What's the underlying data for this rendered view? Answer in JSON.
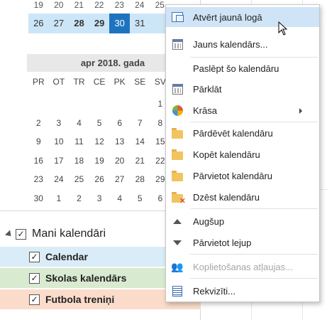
{
  "mini_calendar": {
    "prev_week_row": [
      "19",
      "20",
      "21",
      "22",
      "23",
      "24",
      "25"
    ],
    "selected_week_row": [
      "26",
      "27",
      "28",
      "29",
      "30",
      "31"
    ],
    "month_title": "apr 2018. gada",
    "weekdays": [
      "PR",
      "OT",
      "TR",
      "CE",
      "PK",
      "SE",
      "SV"
    ],
    "weeks": [
      [
        "",
        "",
        "",
        "",
        "",
        "",
        "1"
      ],
      [
        "2",
        "3",
        "4",
        "5",
        "6",
        "7",
        "8"
      ],
      [
        "9",
        "10",
        "11",
        "12",
        "13",
        "14",
        "15"
      ],
      [
        "16",
        "17",
        "18",
        "19",
        "20",
        "21",
        "22"
      ],
      [
        "23",
        "24",
        "25",
        "26",
        "27",
        "28",
        "29"
      ],
      [
        "30",
        "1",
        "2",
        "3",
        "4",
        "5",
        "6"
      ]
    ]
  },
  "calendars": {
    "group_label": "Mani kalendāri",
    "items": [
      {
        "label": "Calendar",
        "color": "#d9ecf7"
      },
      {
        "label": "Skolas kalendārs",
        "color": "#d8ead0"
      },
      {
        "label": "Futbola treniņi",
        "color": "#fbdccb"
      }
    ]
  },
  "context_menu": {
    "items": [
      {
        "label": "Atvērt jaunā logā",
        "icon": "new-window-icon",
        "highlighted": true
      },
      {
        "label": "Jauns kalendārs...",
        "icon": "new-calendar-icon"
      },
      {
        "label": "Paslēpt šo kalendāru",
        "icon": ""
      },
      {
        "label": "Pārklāt",
        "icon": "overlay-icon"
      },
      {
        "label": "Krāsa",
        "icon": "color-icon",
        "submenu": true
      },
      {
        "label": "Pārdēvēt kalendāru",
        "icon": "rename-folder-icon"
      },
      {
        "label": "Kopēt kalendāru",
        "icon": "copy-folder-icon"
      },
      {
        "label": "Pārvietot kalendāru",
        "icon": "move-folder-icon"
      },
      {
        "label": "Dzēst kalendāru",
        "icon": "delete-folder-icon"
      },
      {
        "label": "Augšup",
        "icon": "move-up-icon"
      },
      {
        "label": "Pārvietot lejup",
        "icon": "move-down-icon"
      },
      {
        "label": "Koplietošanas atļaujas...",
        "icon": "sharing-permissions-icon",
        "disabled": true
      },
      {
        "label": "Rekvizīti...",
        "icon": "properties-icon"
      }
    ]
  },
  "colors": {
    "today_highlight": "#1e73be",
    "selected_week": "#cde6f7",
    "menu_highlight": "#cfe4f6"
  }
}
